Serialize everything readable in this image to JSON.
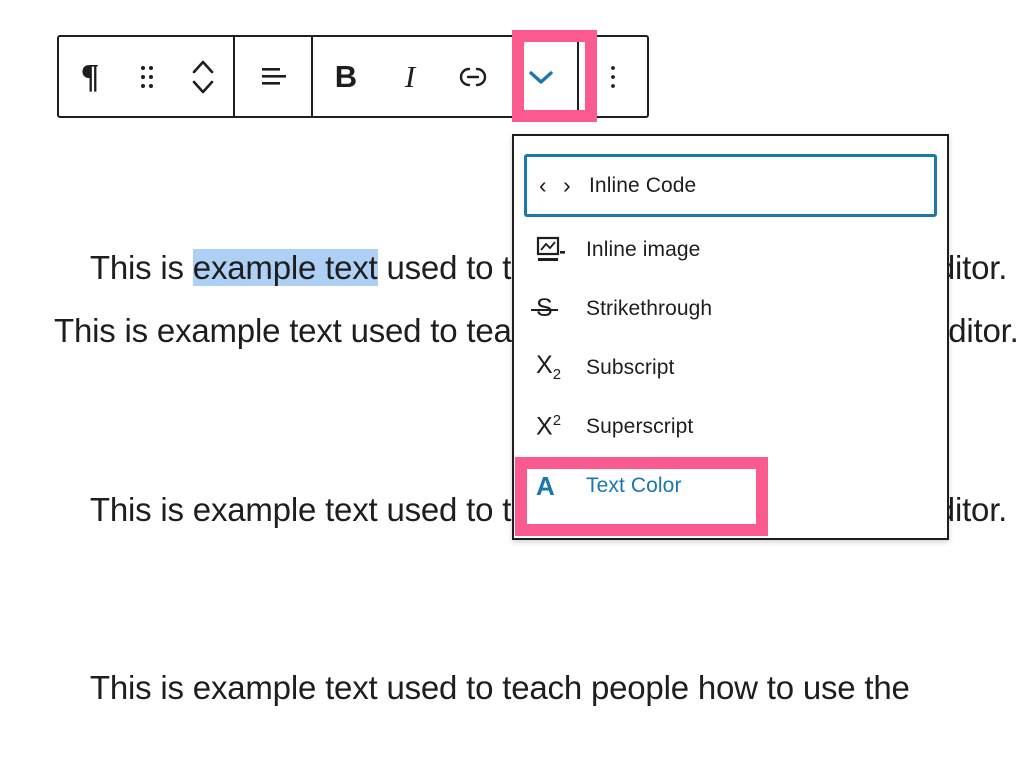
{
  "colors": {
    "highlight_pink": "#fa5a8d",
    "accent_blue": "#1b77ad",
    "selection_blue": "#aed0f5",
    "text_black": "#1e1e1e"
  },
  "editor": {
    "paragraphs": [
      {
        "id": "p-top",
        "text_before": "This is example text used to teach ",
        "text_selected": "",
        "text_after": "",
        "full_text": "This is example text used to teach"
      },
      {
        "id": "p-one",
        "text_before": "This is ",
        "text_selected": "example text",
        "text_after": " used to teach people how to use the editor. This is example text used to teach people how to Gutenberg editor."
      },
      {
        "id": "p-two",
        "text_before": "This is example text used to teach people how to use the editor.",
        "text_selected": "",
        "text_after": ""
      },
      {
        "id": "p-three",
        "text_before": "This is example text used to teach people how to use the",
        "text_selected": "",
        "text_after": ""
      }
    ]
  },
  "toolbar": {
    "buttons": [
      {
        "name": "paragraph-block-type",
        "label": "Paragraph",
        "glyph": "¶",
        "icon": "pilcrow-icon"
      },
      {
        "name": "drag-handle",
        "label": "Drag",
        "icon": "drag-handle-icon"
      },
      {
        "name": "move-up-down",
        "label": "Move up or down",
        "icon": "move-chevrons-icon"
      },
      {
        "name": "align-text",
        "label": "Align text",
        "icon": "align-left-icon"
      },
      {
        "name": "bold",
        "label": "B",
        "icon": "bold-icon"
      },
      {
        "name": "italic",
        "label": "I",
        "icon": "italic-icon"
      },
      {
        "name": "link",
        "label": "Link",
        "icon": "link-icon"
      },
      {
        "name": "more-rich-text-controls",
        "label": "More",
        "icon": "chevron-down-icon",
        "state": "active"
      },
      {
        "name": "more-options",
        "label": "Options",
        "icon": "kebab-vertical-icon"
      }
    ]
  },
  "dropdown": {
    "items": [
      {
        "label": "Inline Code",
        "icon": "inline-code-icon",
        "state": "focused"
      },
      {
        "label": "Inline image",
        "icon": "inline-image-icon",
        "state": "normal"
      },
      {
        "label": "Strikethrough",
        "icon": "strikethrough-icon",
        "state": "normal"
      },
      {
        "label": "Subscript",
        "icon": "subscript-icon",
        "state": "normal"
      },
      {
        "label": "Superscript",
        "icon": "superscript-icon",
        "state": "normal"
      },
      {
        "label": "Text Color",
        "icon": "text-color-icon",
        "state": "highlighted"
      }
    ],
    "glyphs": {
      "inline_code": "‹ ›",
      "strikethrough": "S",
      "subscript_base": "X",
      "subscript_mark": "2",
      "superscript_base": "X",
      "superscript_mark": "2",
      "text_color": "A"
    }
  }
}
